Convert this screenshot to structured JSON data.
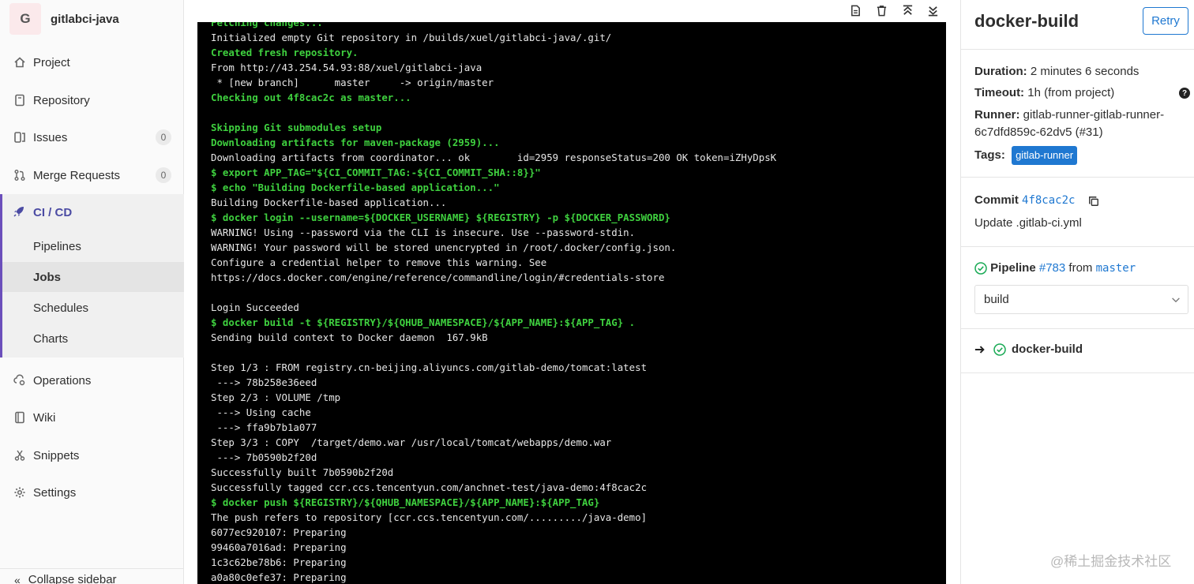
{
  "project": {
    "avatar_letter": "G",
    "name": "gitlabci-java"
  },
  "nav": {
    "project": "Project",
    "repository": "Repository",
    "issues": {
      "label": "Issues",
      "count": "0"
    },
    "merge_requests": {
      "label": "Merge Requests",
      "count": "0"
    },
    "cicd": "CI / CD",
    "cicd_sub": [
      "Pipelines",
      "Jobs",
      "Schedules",
      "Charts"
    ],
    "operations": "Operations",
    "wiki": "Wiki",
    "snippets": "Snippets",
    "settings": "Settings",
    "collapse": "Collapse sidebar"
  },
  "log_lines": [
    {
      "text": "Fetching changes...",
      "style": "g"
    },
    {
      "text": "Initialized empty Git repository in /builds/xuel/gitlabci-java/.git/",
      "style": ""
    },
    {
      "text": "Created fresh repository.",
      "style": "g"
    },
    {
      "text": "From http://43.254.54.93:88/xuel/gitlabci-java",
      "style": ""
    },
    {
      "text": " * [new branch]      master     -> origin/master",
      "style": ""
    },
    {
      "text": "Checking out 4f8cac2c as master...",
      "style": "g"
    },
    {
      "text": "",
      "style": ""
    },
    {
      "text": "Skipping Git submodules setup",
      "style": "g"
    },
    {
      "text": "Downloading artifacts for maven-package (2959)...",
      "style": "g"
    },
    {
      "text": "Downloading artifacts from coordinator... ok        id=2959 responseStatus=200 OK token=iZHyDpsK",
      "style": ""
    },
    {
      "text": "$ export APP_TAG=\"${CI_COMMIT_TAG:-${CI_COMMIT_SHA::8}}\"",
      "style": "g"
    },
    {
      "text": "$ echo \"Building Dockerfile-based application...\"",
      "style": "g"
    },
    {
      "text": "Building Dockerfile-based application...",
      "style": ""
    },
    {
      "text": "$ docker login --username=${DOCKER_USERNAME} ${REGISTRY} -p ${DOCKER_PASSWORD}",
      "style": "g"
    },
    {
      "text": "WARNING! Using --password via the CLI is insecure. Use --password-stdin.",
      "style": ""
    },
    {
      "text": "WARNING! Your password will be stored unencrypted in /root/.docker/config.json.",
      "style": ""
    },
    {
      "text": "Configure a credential helper to remove this warning. See",
      "style": ""
    },
    {
      "text": "https://docs.docker.com/engine/reference/commandline/login/#credentials-store",
      "style": ""
    },
    {
      "text": "",
      "style": ""
    },
    {
      "text": "Login Succeeded",
      "style": ""
    },
    {
      "text": "$ docker build -t ${REGISTRY}/${QHUB_NAMESPACE}/${APP_NAME}:${APP_TAG} .",
      "style": "g"
    },
    {
      "text": "Sending build context to Docker daemon  167.9kB",
      "style": ""
    },
    {
      "text": "",
      "style": ""
    },
    {
      "text": "Step 1/3 : FROM registry.cn-beijing.aliyuncs.com/gitlab-demo/tomcat:latest",
      "style": ""
    },
    {
      "text": " ---> 78b258e36eed",
      "style": ""
    },
    {
      "text": "Step 2/3 : VOLUME /tmp",
      "style": ""
    },
    {
      "text": " ---> Using cache",
      "style": ""
    },
    {
      "text": " ---> ffa9b7b1a077",
      "style": ""
    },
    {
      "text": "Step 3/3 : COPY  /target/demo.war /usr/local/tomcat/webapps/demo.war",
      "style": ""
    },
    {
      "text": " ---> 7b0590b2f20d",
      "style": ""
    },
    {
      "text": "Successfully built 7b0590b2f20d",
      "style": ""
    },
    {
      "text": "Successfully tagged ccr.ccs.tencentyun.com/anchnet-test/java-demo:4f8cac2c",
      "style": ""
    },
    {
      "text": "$ docker push ${REGISTRY}/${QHUB_NAMESPACE}/${APP_NAME}:${APP_TAG}",
      "style": "g"
    },
    {
      "text": "The push refers to repository [ccr.ccs.tencentyun.com/........./java-demo]",
      "style": ""
    },
    {
      "text": "6077ec920107: Preparing",
      "style": ""
    },
    {
      "text": "99460a7016ad: Preparing",
      "style": ""
    },
    {
      "text": "1c3c62be78b6: Preparing",
      "style": ""
    },
    {
      "text": "a0a80c0efe37: Preparing",
      "style": ""
    }
  ],
  "job": {
    "title": "docker-build",
    "retry_label": "Retry",
    "duration_label": "Duration:",
    "duration_value": "2 minutes 6 seconds",
    "timeout_label": "Timeout:",
    "timeout_value": "1h (from project)",
    "runner_label": "Runner:",
    "runner_value": "gitlab-runner-gitlab-runner-",
    "runner_value2": "6c7dfd859c-62dv5 (#31)",
    "tags_label": "Tags:",
    "tag": "gitlab-runner",
    "commit_label": "Commit",
    "commit_sha": "4f8cac2c",
    "commit_message": "Update .gitlab-ci.yml",
    "pipeline_label": "Pipeline",
    "pipeline_id": "#783",
    "pipeline_from": "from",
    "pipeline_branch": "master",
    "stage_select": "build",
    "stage_job": "docker-build"
  },
  "watermark": "@稀土掘金技术社区",
  "colors": {
    "accent": "#1f78d1",
    "cicd": "#6b4fbb",
    "log_green": "#3fd13f",
    "success": "#1aaa55"
  }
}
